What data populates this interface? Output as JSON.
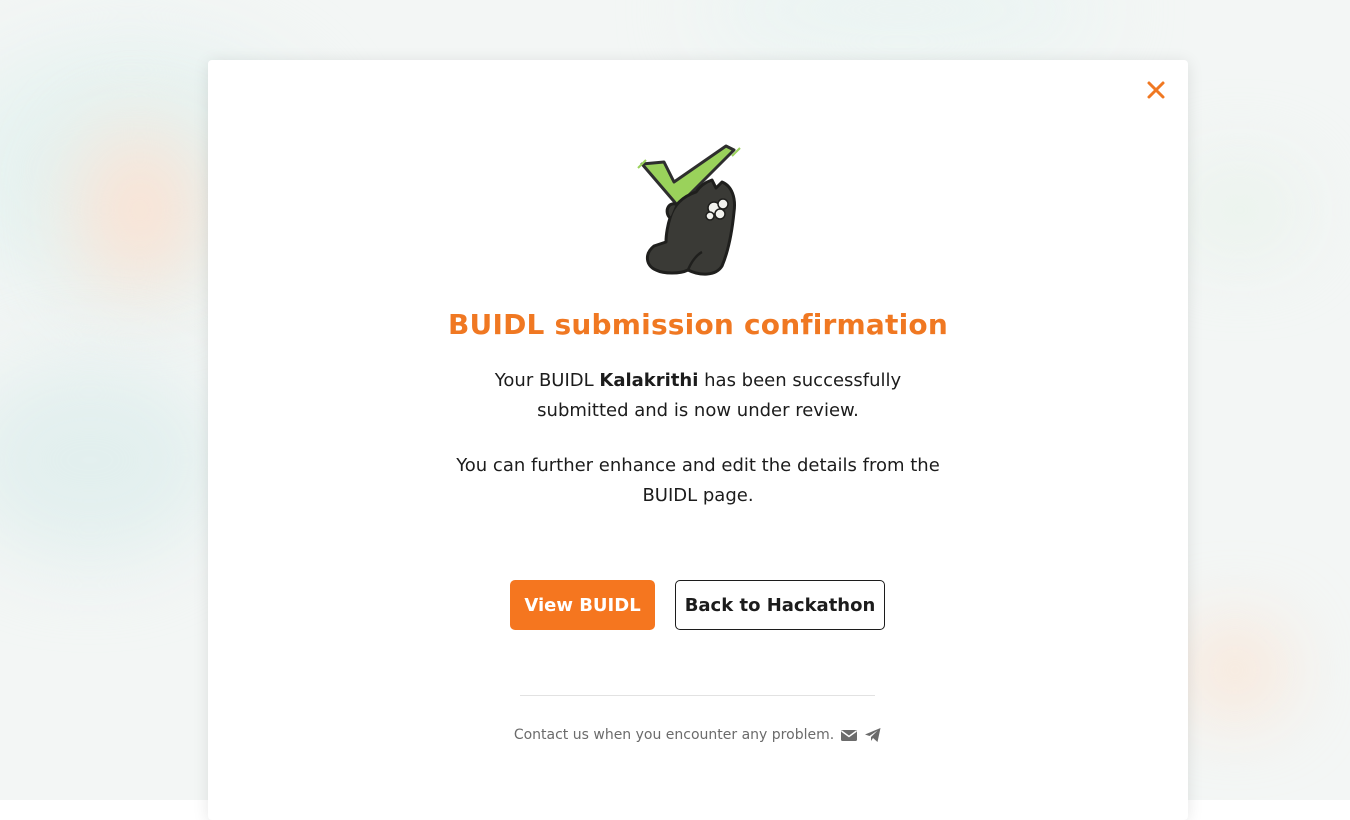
{
  "backdrop": {
    "colors": [
      "#e7f2f1",
      "#fbe6d8",
      "#e4efe7",
      "#fde3cf"
    ]
  },
  "modal": {
    "close_icon": "close-icon",
    "illustration": "cat-checkmark-illustration",
    "title": "BUIDL submission confirmation",
    "message1": {
      "before": "Your BUIDL ",
      "name": "Kalakrithi",
      "after": " has been successfully submitted and is now under review."
    },
    "message2": "You can further enhance and edit the details from the BUIDL page.",
    "primary_button": "View BUIDL",
    "secondary_button": "Back to Hackathon",
    "footer": {
      "text": "Contact us when you encounter any problem.",
      "icons": [
        "email-icon",
        "telegram-icon"
      ]
    },
    "accent_color": "#f5761f"
  }
}
